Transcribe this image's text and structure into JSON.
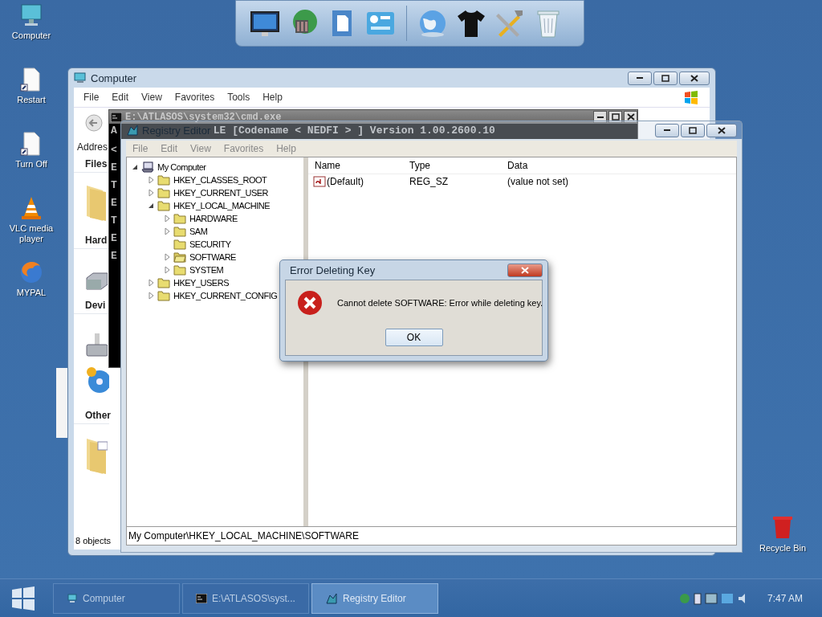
{
  "desktop_icons": [
    {
      "label": "Computer",
      "kind": "computer"
    },
    {
      "label": "Restart",
      "kind": "document"
    },
    {
      "label": "Turn Off",
      "kind": "document"
    },
    {
      "label": "VLC media player",
      "kind": "cone"
    },
    {
      "label": "MYPAL",
      "kind": "browser"
    }
  ],
  "recycle_bin": {
    "label": "Recycle Bin"
  },
  "computer_window": {
    "title": "Computer",
    "menu": [
      "File",
      "Edit",
      "View",
      "Favorites",
      "Tools",
      "Help"
    ],
    "address_label": "Addres",
    "sections": [
      "Files",
      "Hard",
      "Devi",
      "Other"
    ],
    "status": "8 objects"
  },
  "cmd_window": {
    "title": "E:\\ATLASOS\\system32\\cmd.exe",
    "banner": "LE [Codename < NEDFI > ] Version 1.00.2600.10",
    "lines": [
      {
        "text": "A"
      },
      {
        "text": "<"
      },
      {
        "text": "E"
      },
      {
        "text": "T"
      },
      {
        "text": "E"
      },
      {
        "text": "T"
      },
      {
        "text": "E"
      },
      {
        "text": "E"
      }
    ]
  },
  "registry_editor": {
    "title": "Registry Editor",
    "menu": [
      "File",
      "Edit",
      "View",
      "Favorites",
      "Help"
    ],
    "tree": [
      {
        "label": "My Computer",
        "kind": "computer",
        "expandable": true,
        "expanded": true,
        "selected": false,
        "children": [
          {
            "label": "HKEY_CLASSES_ROOT",
            "kind": "key",
            "expandable": true,
            "expanded": false,
            "selected": false
          },
          {
            "label": "HKEY_CURRENT_USER",
            "kind": "key",
            "expandable": true,
            "expanded": false,
            "selected": false
          },
          {
            "label": "HKEY_LOCAL_MACHINE",
            "kind": "key",
            "expandable": true,
            "expanded": true,
            "selected": false,
            "children": [
              {
                "label": "HARDWARE",
                "kind": "key",
                "expandable": true,
                "expanded": false,
                "selected": false
              },
              {
                "label": "SAM",
                "kind": "key",
                "expandable": true,
                "expanded": false,
                "selected": false
              },
              {
                "label": "SECURITY",
                "kind": "key",
                "expandable": false,
                "expanded": false,
                "selected": false
              },
              {
                "label": "SOFTWARE",
                "kind": "key",
                "expandable": true,
                "expanded": false,
                "selected": true
              },
              {
                "label": "SYSTEM",
                "kind": "key",
                "expandable": true,
                "expanded": false,
                "selected": false
              }
            ]
          },
          {
            "label": "HKEY_USERS",
            "kind": "key",
            "expandable": true,
            "expanded": false,
            "selected": false
          },
          {
            "label": "HKEY_CURRENT_CONFIG",
            "kind": "key",
            "expandable": true,
            "expanded": false,
            "selected": false
          }
        ]
      }
    ],
    "columns": [
      "Name",
      "Type",
      "Data"
    ],
    "values": [
      {
        "name": "(Default)",
        "type": "REG_SZ",
        "data": "(value not set)"
      }
    ],
    "status": "My Computer\\HKEY_LOCAL_MACHINE\\SOFTWARE"
  },
  "dialog": {
    "title": "Error Deleting Key",
    "message": "Cannot delete SOFTWARE:  Error while deleting key.",
    "button": "OK"
  },
  "taskbar": {
    "tasks": [
      {
        "label": "Computer",
        "kind": "explorer",
        "selected": false
      },
      {
        "label": "E:\\ATLASOS\\syst...",
        "kind": "console",
        "selected": false
      },
      {
        "label": "Registry Editor",
        "kind": "registry",
        "selected": true
      }
    ],
    "clock": "7:47 AM"
  }
}
